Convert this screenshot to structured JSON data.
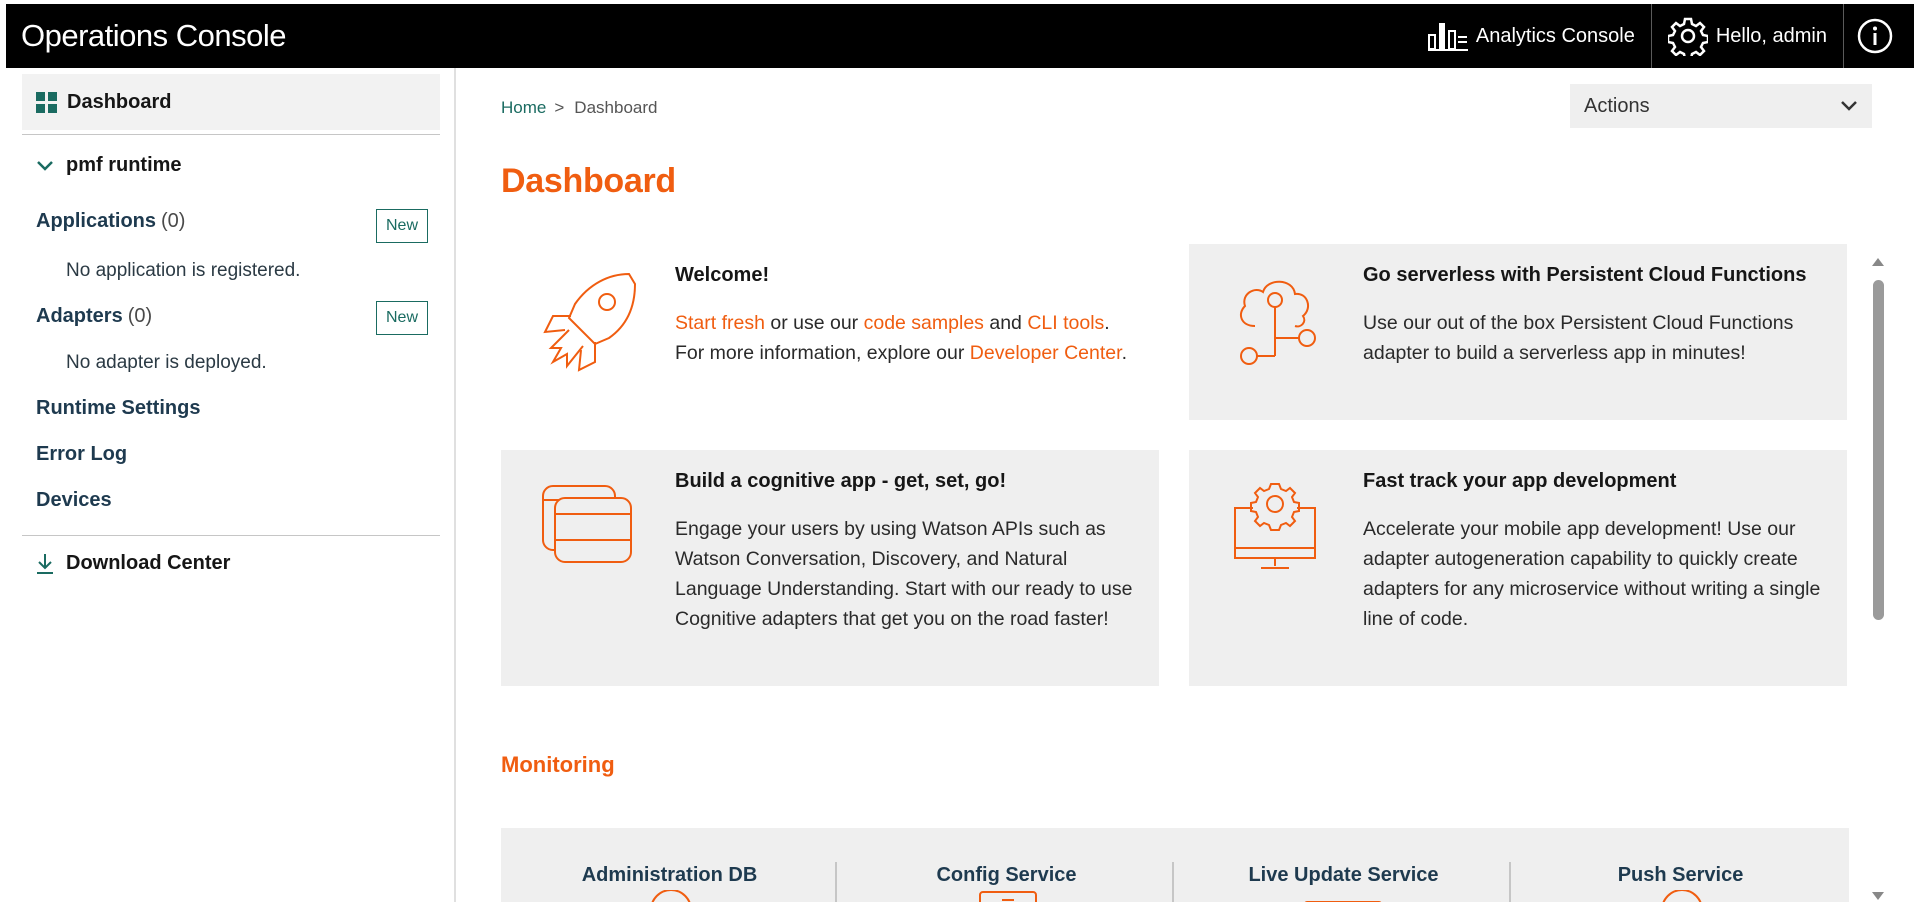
{
  "header": {
    "title": "Operations Console",
    "analytics_label": "Analytics Console",
    "user_label": "Hello, admin"
  },
  "sidebar": {
    "dashboard_label": "Dashboard",
    "runtime_label": "pmf runtime",
    "applications": {
      "label": "Applications",
      "count": "(0)",
      "new_label": "New",
      "empty_text": "No application is registered."
    },
    "adapters": {
      "label": "Adapters",
      "count": "(0)",
      "new_label": "New",
      "empty_text": "No adapter is deployed."
    },
    "items": [
      {
        "label": "Runtime Settings"
      },
      {
        "label": "Error Log"
      },
      {
        "label": "Devices"
      }
    ],
    "download_label": "Download Center"
  },
  "breadcrumb": {
    "home": "Home",
    "separator": ">",
    "current": "Dashboard"
  },
  "actions": {
    "label": "Actions"
  },
  "page_title": "Dashboard",
  "cards": {
    "welcome": {
      "title": "Welcome!",
      "link_start_fresh": "Start fresh",
      "text_1": "or use our",
      "link_code_samples": "code samples",
      "text_2": "and",
      "link_cli_tools": "CLI tools",
      "text_3": ".",
      "text_4": "For more information, explore our",
      "link_developer_center": "Developer Center",
      "text_5": "."
    },
    "serverless": {
      "title": "Go serverless with Persistent Cloud Functions",
      "body": "Use our out of the box Persistent Cloud Functions adapter to build a serverless app in minutes!"
    },
    "cognitive": {
      "title": "Build a cognitive app - get, set, go!",
      "body": "Engage your users by using Watson APIs such as Watson Conversation, Discovery, and Natural Language Understanding. Start with our ready to use Cognitive adapters that get you on the road faster!"
    },
    "fasttrack": {
      "title": "Fast track your app development",
      "body": "Accelerate your mobile app development! Use our adapter autogeneration capability to quickly create adapters for any microservice without writing a single line of code."
    }
  },
  "monitoring": {
    "title": "Monitoring",
    "services": [
      {
        "label": "Administration DB"
      },
      {
        "label": "Config Service"
      },
      {
        "label": "Live Update Service"
      },
      {
        "label": "Push Service"
      }
    ]
  },
  "colors": {
    "accent_orange": "#f05d10",
    "teal": "#1a6b61",
    "topbar": "#000000",
    "card_bg": "#efefef"
  },
  "icons": {
    "analytics": "bar-chart-icon",
    "settings": "gear-icon",
    "info": "info-icon",
    "dashboard": "grid-icon",
    "runtime": "chevron-down-icon",
    "download": "download-icon",
    "actions": "chevron-down-icon",
    "welcome": "rocket-icon",
    "serverless": "cloud-functions-icon",
    "cognitive": "stacked-cards-icon",
    "fasttrack": "monitor-gear-icon"
  }
}
